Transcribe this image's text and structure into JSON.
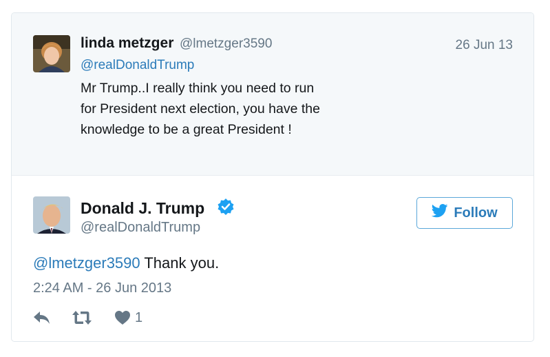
{
  "quoted_tweet": {
    "author_name": "linda metzger",
    "author_handle": "@lmetzger3590",
    "date": "26 Jun 13",
    "reply_to": "@realDonaldTrump",
    "text": "Mr Trump..I really think you need to run for President next election, you have the knowledge to be a great President !",
    "avatar": "user-avatar"
  },
  "main_tweet": {
    "author_name": "Donald J. Trump",
    "author_handle": "@realDonaldTrump",
    "verified_icon": "verified-badge-icon",
    "follow_label": "Follow",
    "mention": "@lmetzger3590",
    "text": " Thank you.",
    "timestamp": "2:24 AM - 26 Jun 2013",
    "like_count": "1",
    "avatar": "user-avatar"
  },
  "icons": {
    "reply": "reply-icon",
    "retweet": "retweet-icon",
    "like": "heart-icon",
    "twitter": "twitter-bird-icon"
  },
  "colors": {
    "link": "#2b7bb9",
    "muted": "#657786",
    "verified": "#1da1f2",
    "quoted_bg": "#f5f8fa"
  }
}
